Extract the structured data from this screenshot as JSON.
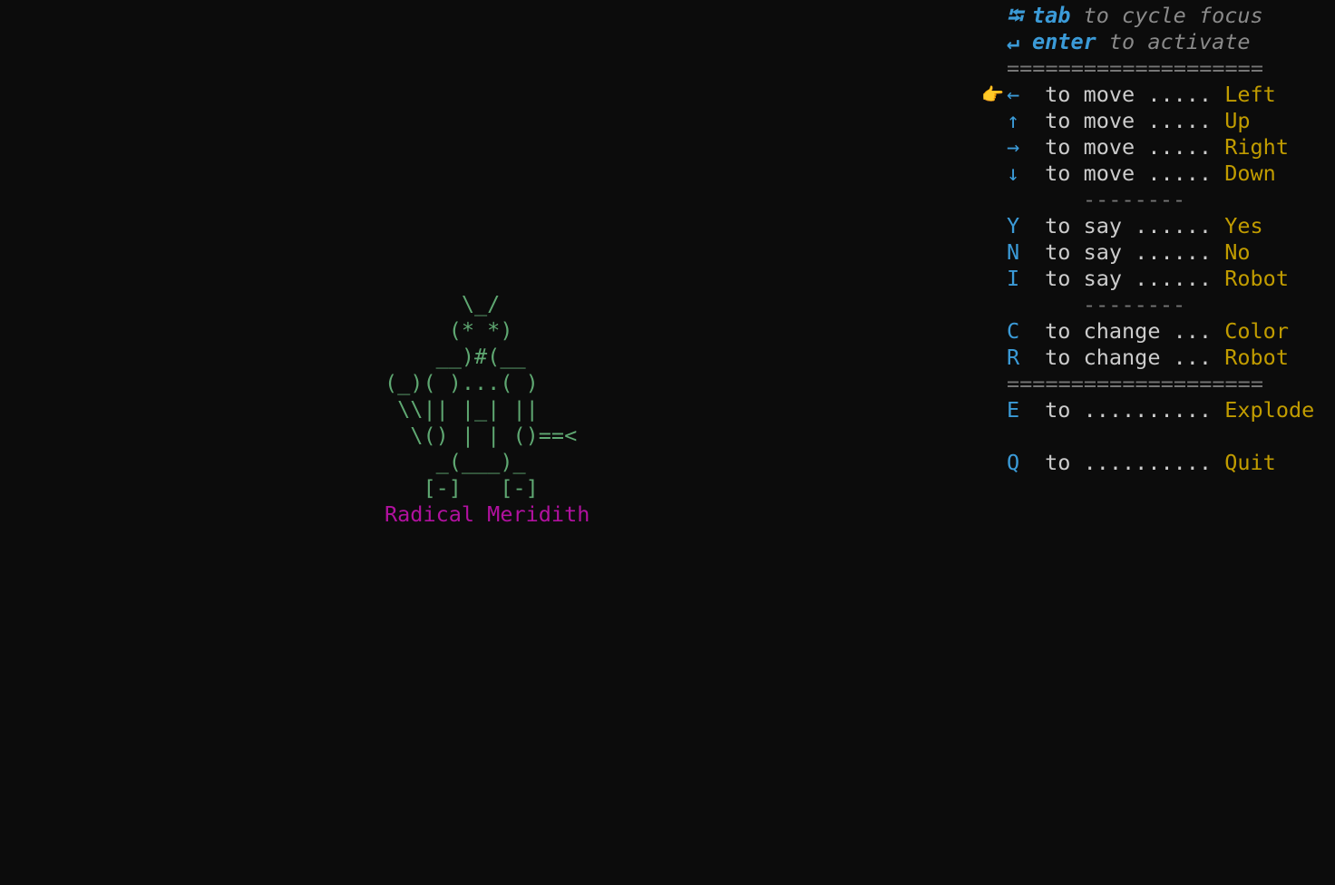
{
  "robot": {
    "art": "      \\_/\n     (* *)\n    __)#(__\n(_)( )...( )\n \\\\|| |_| ||\n  \\() | | ()==<\n    _(___)_\n   [-]   [-]",
    "name": "Radical Meridith"
  },
  "focus_hints": [
    {
      "icon": "⭾",
      "key": "tab",
      "text": " to cycle focus"
    },
    {
      "icon": "↵",
      "key": "enter",
      "text": " to activate"
    }
  ],
  "separator_major": "====================",
  "separator_minor": "--------",
  "pointer_icon": "👉",
  "move_keys": [
    {
      "key": "←",
      "verb": " to move ..... ",
      "value": "Left"
    },
    {
      "key": "↑",
      "verb": " to move ..... ",
      "value": "Up"
    },
    {
      "key": "→",
      "verb": " to move ..... ",
      "value": "Right"
    },
    {
      "key": "↓",
      "verb": " to move ..... ",
      "value": "Down"
    }
  ],
  "say_keys": [
    {
      "key": "Y",
      "verb": " to say ...... ",
      "value": "Yes"
    },
    {
      "key": "N",
      "verb": " to say ...... ",
      "value": "No"
    },
    {
      "key": "I",
      "verb": " to say ...... ",
      "value": "Robot"
    }
  ],
  "change_keys": [
    {
      "key": "C",
      "verb": " to change ... ",
      "value": "Color"
    },
    {
      "key": "R",
      "verb": " to change ... ",
      "value": "Robot"
    }
  ],
  "explode": {
    "key": "E",
    "verb": " to .......... ",
    "value": "Explode"
  },
  "quit": {
    "key": "Q",
    "verb": " to .......... ",
    "value": "Quit"
  },
  "colors": {
    "background": "#0c0c0c",
    "robot": "#5fa872",
    "name": "#b1119f",
    "key": "#3b9bd8",
    "value": "#c19c00"
  }
}
